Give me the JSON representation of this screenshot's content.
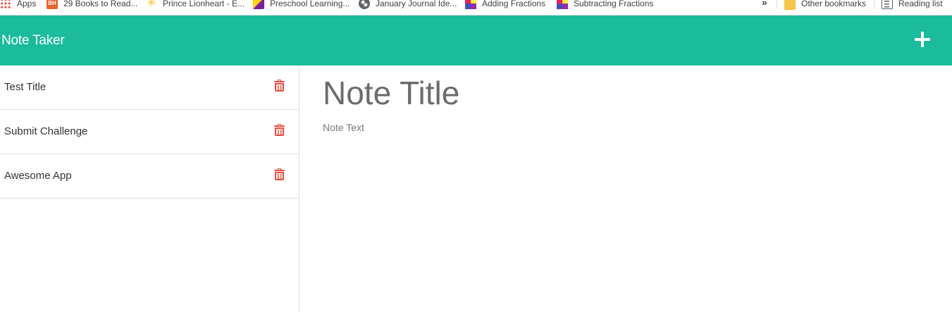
{
  "bookmarks": {
    "items": [
      {
        "label": "Apps",
        "icon": "apps-grid-icon"
      },
      {
        "label": "29 Books to Read...",
        "icon": "bh-icon"
      },
      {
        "label": "Prince Lionheart - E...",
        "icon": "walmart-spark-icon"
      },
      {
        "label": "Preschool Learning...",
        "icon": "preschool-icon"
      },
      {
        "label": "January Journal Ide...",
        "icon": "globe-icon"
      },
      {
        "label": "Adding Fractions",
        "icon": "fractions-icon"
      },
      {
        "label": "Subtracting Fractions",
        "icon": "fractions-icon"
      }
    ],
    "more_label": "»",
    "other_bookmarks": "Other bookmarks",
    "reading_list": "Reading list"
  },
  "navbar": {
    "brand": "Note Taker",
    "accent_color": "#1abc9c",
    "add_icon": "plus-icon"
  },
  "notes": [
    {
      "title": "Test Title"
    },
    {
      "title": "Submit Challenge"
    },
    {
      "title": "Awesome App"
    }
  ],
  "delete_icon_color": "#e74c3c",
  "editor": {
    "title_placeholder": "Note Title",
    "text_placeholder": "Note Text"
  }
}
